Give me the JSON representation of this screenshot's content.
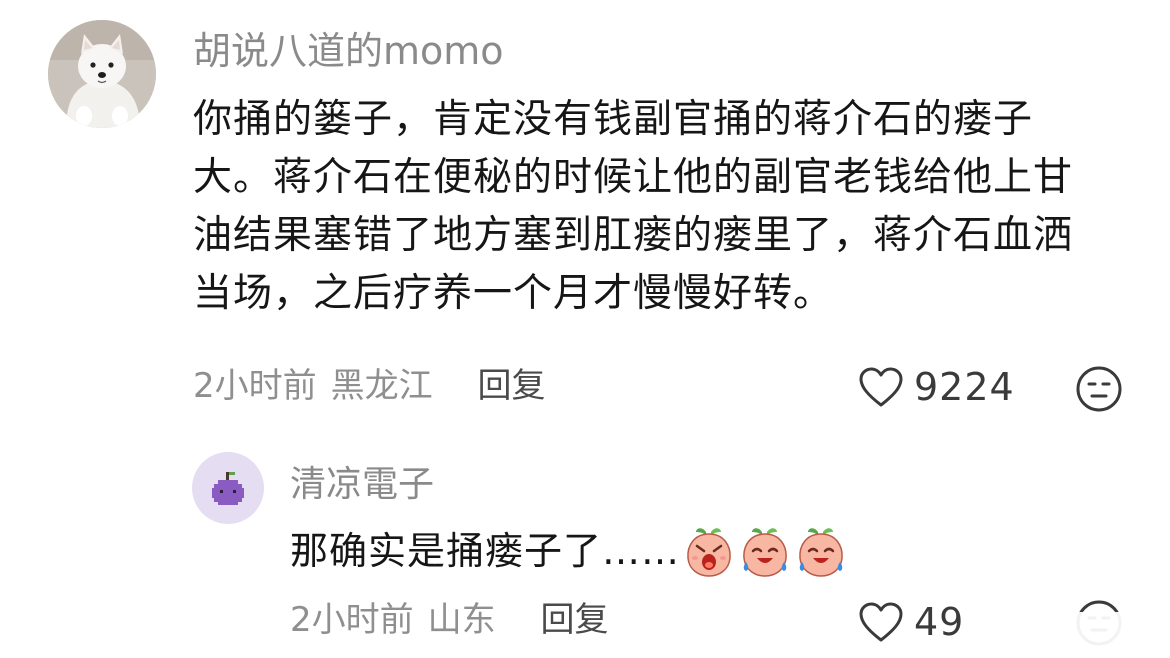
{
  "main_comment": {
    "avatar": "samoyed-dog-avatar",
    "username": "胡说八道的momo",
    "body_lines": [
      "你捅的篓子，肯定没有钱副官捅的蒋介石的瘘子",
      "大。蒋介石在便秘的时候让他的副官老钱给他上甘",
      "油结果塞错了地方塞到肛瘘的瘘里了，蒋介石血洒",
      "当场，之后疗养一个月才慢慢好转。"
    ],
    "time": "2小时前",
    "location": "黑龙江",
    "reply_label": "回复",
    "like_icon": "heart-outline-icon",
    "like_count": "9224",
    "dislike_icon": "unamused-face-icon"
  },
  "sub_comment": {
    "avatar": "purple-fruit-pixel-avatar",
    "username": "清凉電子",
    "body": "那确实是捅瘘子了……",
    "emojis": [
      "shocked-peach-emoji",
      "crying-peach-emoji",
      "crying-peach-emoji"
    ],
    "time": "2小时前",
    "location": "山东",
    "reply_label": "回复",
    "like_icon": "heart-outline-icon",
    "like_count_visible": "49",
    "dislike_icon": "unamused-face-icon"
  },
  "colors": {
    "text_primary": "#161616",
    "text_secondary": "#8a8a8a",
    "background": "#ffffff",
    "icon_stroke": "#3a3a3a"
  }
}
